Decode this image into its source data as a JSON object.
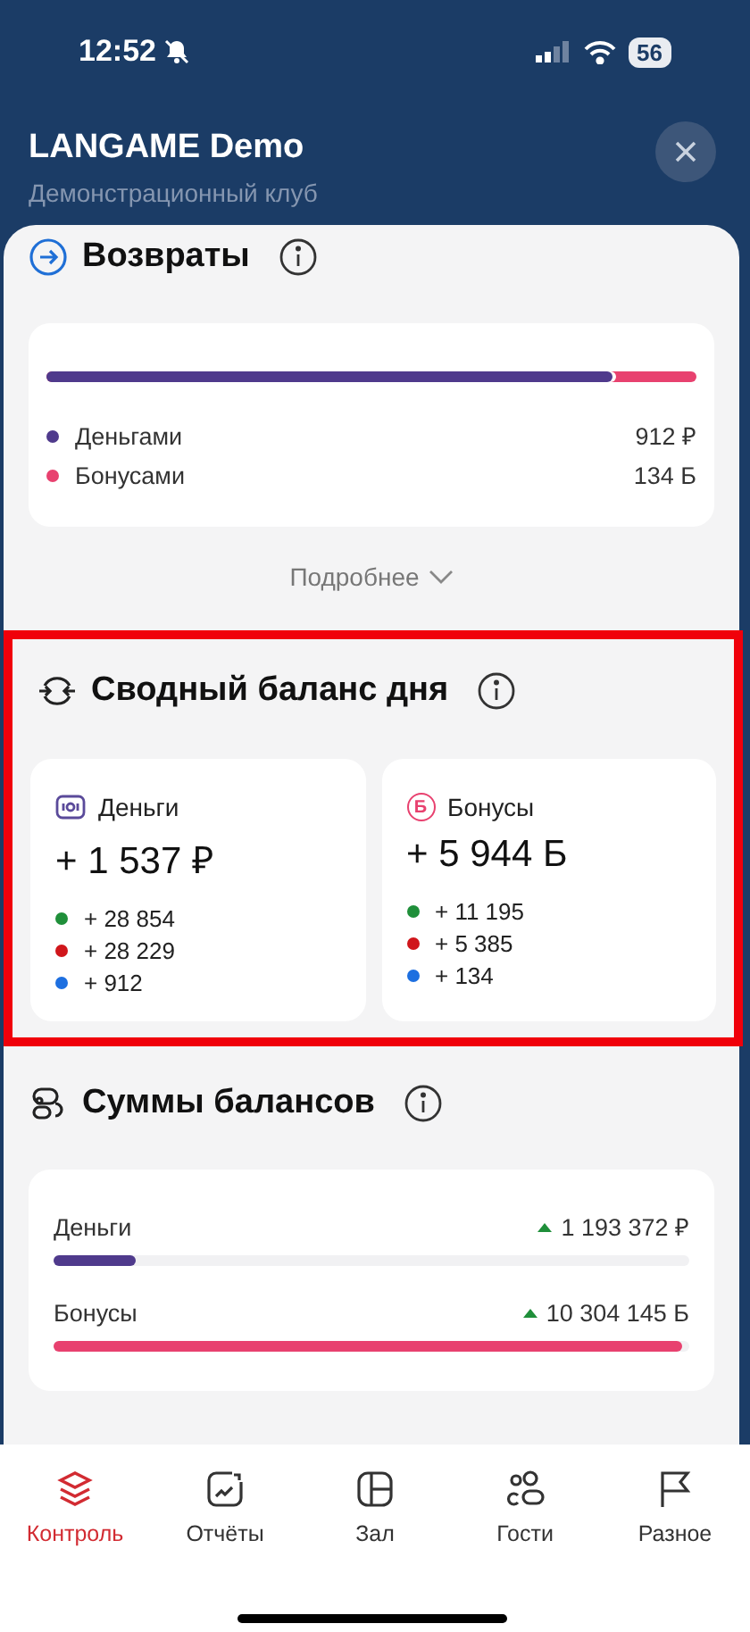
{
  "status_bar": {
    "time": "12:52",
    "battery": "56"
  },
  "header": {
    "title": "LANGAME Demo",
    "subtitle": "Демонстрационный клуб"
  },
  "returns": {
    "title": "Возвраты",
    "more": "Подробнее",
    "level": 0.87,
    "items": [
      {
        "label": "Деньгами",
        "value": "912 ₽",
        "color": "#4f3a8c"
      },
      {
        "label": "Бонусами",
        "value": "134 Б",
        "color": "#e8416f"
      }
    ]
  },
  "summary": {
    "title": "Сводный баланс дня",
    "highlighted": true,
    "cards": [
      {
        "kind": "money",
        "label": "Деньги",
        "total": "+ 1 537 ₽",
        "lines": [
          {
            "value": "+ 28 854",
            "color": "#1f8f3a"
          },
          {
            "value": "+ 28 229",
            "color": "#d0161b"
          },
          {
            "value": "+ 912",
            "color": "#1d6fe0"
          }
        ]
      },
      {
        "kind": "bonus",
        "badge": "Б",
        "label": "Бонусы",
        "total": "+ 5 944 Б",
        "lines": [
          {
            "value": "+ 11 195",
            "color": "#1f8f3a"
          },
          {
            "value": "+ 5 385",
            "color": "#d0161b"
          },
          {
            "value": "+ 134",
            "color": "#1d6fe0"
          }
        ]
      }
    ]
  },
  "sums": {
    "title": "Суммы балансов",
    "rows": [
      {
        "label": "Деньги",
        "value": "1 193 372 ₽",
        "rising": true,
        "level": 0.13,
        "color": "#4f3a8c"
      },
      {
        "label": "Бонусы",
        "value": "10 304 145 Б",
        "rising": true,
        "level": 0.99,
        "color": "#e8416f"
      }
    ]
  },
  "tabs": [
    {
      "kind": "layers",
      "label": "Контроль",
      "selected": true
    },
    {
      "kind": "report",
      "label": "Отчёты",
      "selected": false
    },
    {
      "kind": "hall",
      "label": "Зал",
      "selected": false
    },
    {
      "kind": "guests",
      "label": "Гости",
      "selected": false
    },
    {
      "kind": "flag",
      "label": "Разное",
      "selected": false
    }
  ]
}
